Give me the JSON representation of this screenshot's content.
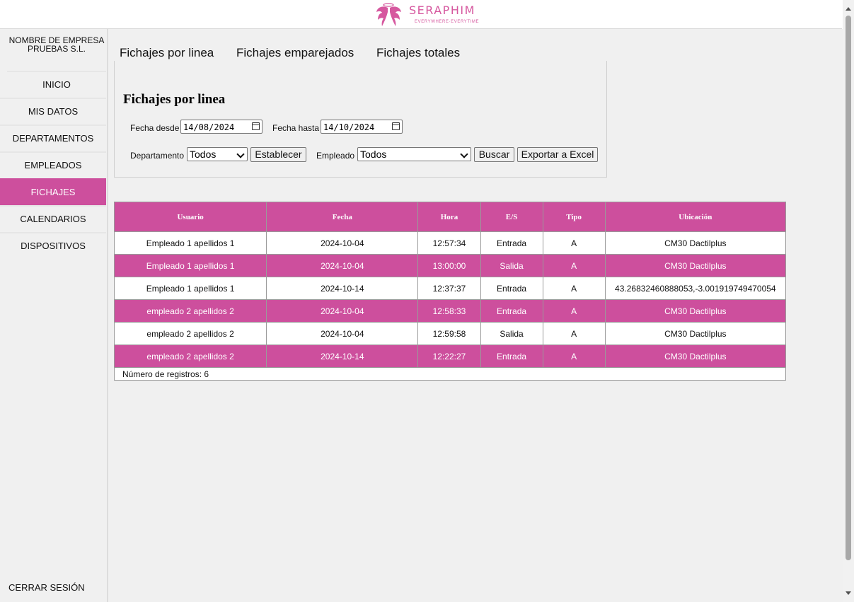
{
  "brand": {
    "name": "SERAPHIM",
    "tagline": "EVERYWHERE·EVERYTIME",
    "color": "#cd4f9d"
  },
  "sidebar": {
    "company": "NOMBRE DE EMPRESA PRUEBAS S.L.",
    "items": [
      {
        "label": "INICIO"
      },
      {
        "label": "MIS DATOS"
      },
      {
        "label": "DEPARTAMENTOS"
      },
      {
        "label": "EMPLEADOS"
      },
      {
        "label": "FICHAJES",
        "active": true
      },
      {
        "label": "CALENDARIOS"
      },
      {
        "label": "DISPOSITIVOS"
      }
    ],
    "logout": "CERRAR SESIÓN"
  },
  "tabs": [
    {
      "label": "Fichajes por linea"
    },
    {
      "label": "Fichajes emparejados"
    },
    {
      "label": "Fichajes totales"
    }
  ],
  "filters": {
    "title": "Fichajes por linea",
    "date_from_label": "Fecha desde",
    "date_from": "14/08/2024",
    "date_to_label": "Fecha hasta",
    "date_to": "14/10/2024",
    "department_label": "Departamento",
    "department_value": "Todos",
    "set_button": "Establecer",
    "employee_label": "Empleado",
    "employee_value": "Todos",
    "search_button": "Buscar",
    "export_button": "Exportar a Excel"
  },
  "table": {
    "headers": [
      "Usuario",
      "Fecha",
      "Hora",
      "E/S",
      "Tipo",
      "Ubicación"
    ],
    "rows": [
      [
        "Empleado 1 apellidos 1",
        "2024-10-04",
        "12:57:34",
        "Entrada",
        "A",
        "CM30 Dactilplus"
      ],
      [
        "Empleado 1 apellidos 1",
        "2024-10-04",
        "13:00:00",
        "Salida",
        "A",
        "CM30 Dactilplus"
      ],
      [
        "Empleado 1 apellidos 1",
        "2024-10-14",
        "12:37:37",
        "Entrada",
        "A",
        "43.26832460888053,-3.001919749470054"
      ],
      [
        "empleado 2 apellidos 2",
        "2024-10-04",
        "12:58:33",
        "Entrada",
        "A",
        "CM30 Dactilplus"
      ],
      [
        "empleado 2 apellidos 2",
        "2024-10-04",
        "12:59:58",
        "Salida",
        "A",
        "CM30 Dactilplus"
      ],
      [
        "empleado 2 apellidos 2",
        "2024-10-14",
        "12:22:27",
        "Entrada",
        "A",
        "CM30 Dactilplus"
      ]
    ],
    "footer": "Número de registros: 6"
  }
}
